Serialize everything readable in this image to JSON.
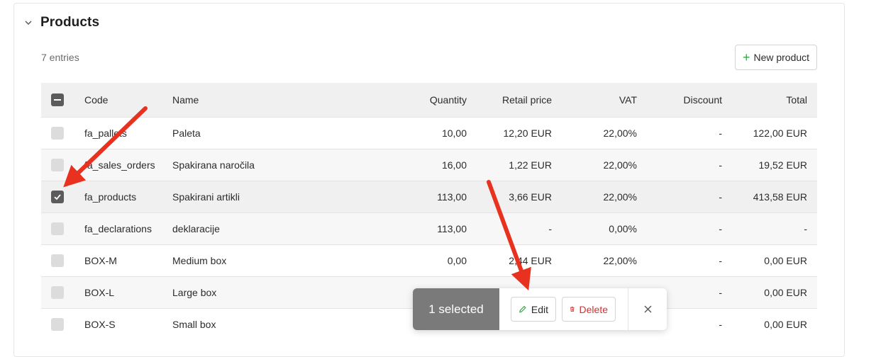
{
  "section": {
    "title": "Products",
    "entries": "7 entries",
    "new_button": "New product"
  },
  "columns": [
    "Code",
    "Name",
    "Quantity",
    "Retail price",
    "VAT",
    "Discount",
    "Total"
  ],
  "rows": [
    {
      "code": "fa_pallets",
      "name": "Paleta",
      "qty": "10,00",
      "price": "12,20 EUR",
      "vat": "22,00%",
      "discount": "-",
      "total": "122,00 EUR",
      "checked": false
    },
    {
      "code": "fa_sales_orders",
      "name": "Spakirana naročila",
      "qty": "16,00",
      "price": "1,22 EUR",
      "vat": "22,00%",
      "discount": "-",
      "total": "19,52 EUR",
      "checked": false
    },
    {
      "code": "fa_products",
      "name": "Spakirani artikli",
      "qty": "113,00",
      "price": "3,66 EUR",
      "vat": "22,00%",
      "discount": "-",
      "total": "413,58 EUR",
      "checked": true
    },
    {
      "code": "fa_declarations",
      "name": "deklaracije",
      "qty": "113,00",
      "price": "-",
      "vat": "0,00%",
      "discount": "-",
      "total": "-",
      "checked": false
    },
    {
      "code": "BOX-M",
      "name": "Medium box",
      "qty": "0,00",
      "price": "2,44 EUR",
      "vat": "22,00%",
      "discount": "-",
      "total": "0,00 EUR",
      "checked": false
    },
    {
      "code": "BOX-L",
      "name": "Large box",
      "qty": "",
      "price": "",
      "vat": "",
      "discount": "-",
      "total": "0,00 EUR",
      "checked": false
    },
    {
      "code": "BOX-S",
      "name": "Small box",
      "qty": "",
      "price": "",
      "vat": "",
      "discount": "-",
      "total": "0,00 EUR",
      "checked": false
    }
  ],
  "bulk": {
    "count": "1 selected",
    "edit": "Edit",
    "delete": "Delete"
  },
  "icons": {
    "collapse": "chevron-down-icon",
    "add": "plus-icon",
    "edit": "pencil-icon",
    "delete": "trash-icon",
    "close": "close-icon"
  },
  "colors": {
    "accent_green": "#3aa547",
    "danger": "#d33030",
    "annotation_arrow": "#e8321f"
  }
}
